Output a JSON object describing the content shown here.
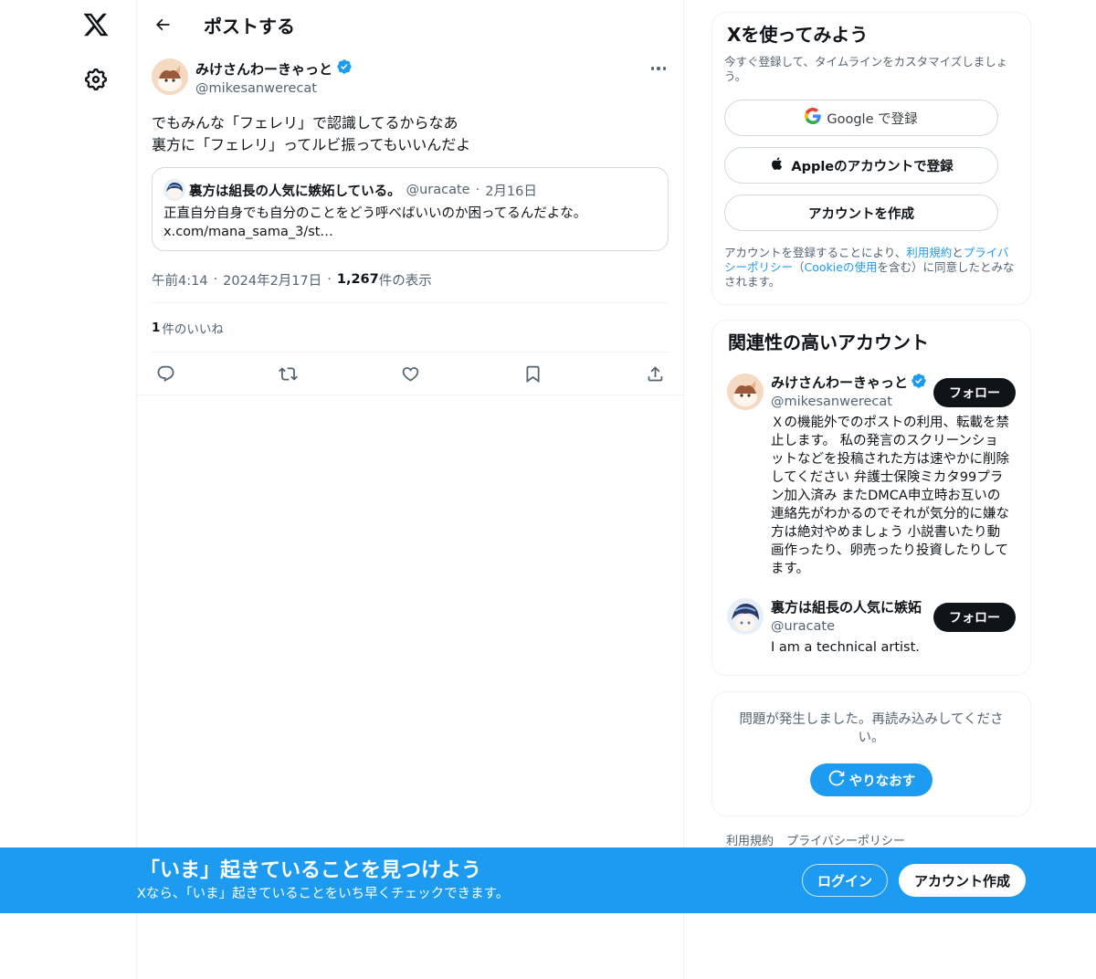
{
  "header": {
    "title": "ポストする"
  },
  "post": {
    "author_name": "みけさんわーきゃっと",
    "author_handle": "@mikesanwerecat",
    "text_line1": "でもみんな「フェレリ」で認識してるからなあ",
    "text_line2": "裏方に「フェレリ」ってルビ振ってもいいんだよ",
    "quote": {
      "name": "裏方は組長の人気に嫉妬している。",
      "handle": "@uracate",
      "dot": "·",
      "date": "2月16日",
      "text_line1": "正直自分自身でも自分のことをどう呼べばいいのか困ってるんだよな。",
      "text_line2": "x.com/mana_sama_3/st…"
    },
    "meta": {
      "time": "午前4:14",
      "dot": "·",
      "date": "2024年2月17日",
      "dot2": "·",
      "views_count": "1,267",
      "views_label": " 件の表示"
    },
    "likes": {
      "count": "1",
      "label": " 件のいいね"
    }
  },
  "signup": {
    "title": "Xを使ってみよう",
    "subtitle": "今すぐ登録して、タイムラインをカスタマイズしましょう。",
    "google_label": "Google で登録",
    "apple_label": "Appleのアカウントで登録",
    "create_label": "アカウントを作成",
    "terms_prefix": "アカウントを登録することにより、",
    "terms_link1": "利用規約",
    "terms_and": "と",
    "terms_link2": "プライバシーポリシー",
    "terms_paren_open": "（",
    "terms_link3": "Cookieの使用",
    "terms_suffix": "を含む）に同意したとみなされます。"
  },
  "recommend": {
    "title": "関連性の高いアカウント",
    "users": [
      {
        "name": "みけさんわーきゃっと",
        "handle": "@mikesanwerecat",
        "bio": "Ｘの機能外でのポストの利用、転載を禁止します。 私の発言のスクリーンショットなどを投稿された方は速やかに削除してください 弁護士保険ミカタ99プラン加入済み またDMCA申立時お互いの連絡先がわかるのでそれが気分的に嫌な方は絶対やめましょう 小説書いたり動画作ったり、卵売ったり投資したりしてます。",
        "follow": "フォロー"
      },
      {
        "name": "裏方は組長の人気に嫉妬",
        "handle": "@uracate",
        "bio": "I am a technical artist.",
        "follow": "フォロー"
      }
    ]
  },
  "error": {
    "text": "問題が発生しました。再読み込みしてください。",
    "retry": "やりなおす"
  },
  "footer": {
    "terms": "利用規約",
    "privacy": "プライバシーポリシー"
  },
  "banner": {
    "title": "「いま」起きていることを見つけよう",
    "subtitle": "Xなら、「いま」起きていることをいち早くチェックできます。",
    "login": "ログイン",
    "create": "アカウント作成"
  },
  "colors": {
    "accent": "#1d9bf0",
    "text": "#0f1419",
    "secondary": "#536471",
    "border": "#eff3f4"
  },
  "icons": [
    "x-logo-icon",
    "gear-icon",
    "back-arrow-icon",
    "verified-badge-icon",
    "more-icon",
    "reply-icon",
    "repost-icon",
    "like-icon",
    "bookmark-icon",
    "share-icon",
    "google-icon",
    "apple-icon",
    "refresh-icon"
  ]
}
